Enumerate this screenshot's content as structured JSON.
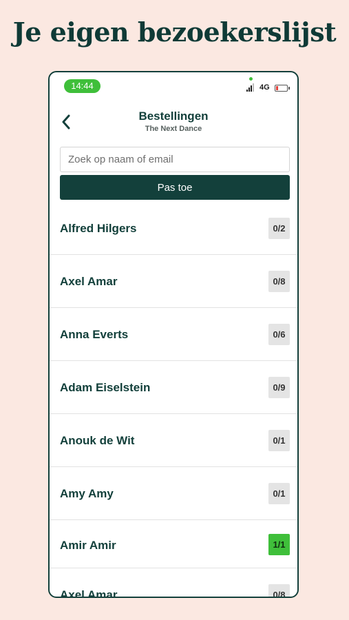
{
  "headline": "Je eigen bezoekerslijst",
  "status_bar": {
    "time": "14:44",
    "network": "4G"
  },
  "nav": {
    "title": "Bestellingen",
    "subtitle": "The Next Dance",
    "back_icon": "chevron-left-icon"
  },
  "search": {
    "placeholder": "Zoek op naam of email",
    "value": ""
  },
  "apply_button": "Pas toe",
  "colors": {
    "brand": "#13403b",
    "accent_green": "#3fbf3a",
    "badge_gray": "#e4e4e4",
    "background": "#fbe8e1"
  },
  "orders": [
    {
      "name": "Alfred Hilgers",
      "count": "0/2",
      "complete": false
    },
    {
      "name": "Axel Amar",
      "count": "0/8",
      "complete": false
    },
    {
      "name": "Anna Everts",
      "count": "0/6",
      "complete": false
    },
    {
      "name": "Adam Eiselstein",
      "count": "0/9",
      "complete": false
    },
    {
      "name": "Anouk de Wit",
      "count": "0/1",
      "complete": false
    },
    {
      "name": "Amy Amy",
      "count": "0/1",
      "complete": false
    },
    {
      "name": "Amir Amir",
      "count": "1/1",
      "complete": true
    },
    {
      "name": "Axel Amar",
      "count": "0/8",
      "complete": false
    }
  ]
}
